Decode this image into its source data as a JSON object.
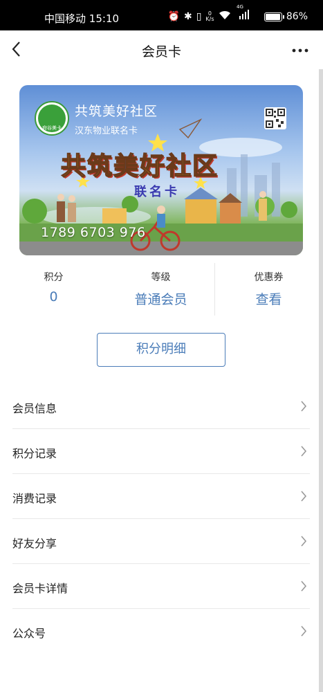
{
  "status_bar": {
    "carrier": "中国移动",
    "time": "15:10",
    "net_speed_value": "0",
    "net_speed_unit": "K/s",
    "network_type": "4G",
    "battery_percent": "86%",
    "battery_level": 0.86,
    "icons": [
      "alarm-icon",
      "bluetooth-icon",
      "vibrate-icon",
      "wifi-icon",
      "signal-icon",
      "battery-icon"
    ]
  },
  "nav": {
    "title": "会员卡",
    "back_icon": "chevron-left-icon",
    "more_icon": "more-dots-icon"
  },
  "card": {
    "org_name": "共筑美好社区",
    "subtitle": "汉东物业联名卡",
    "logo_text": "府谷美卡",
    "banner_title_1": "共筑",
    "banner_title_2": "美",
    "banner_title_3": "好社区",
    "banner_label": "联名卡",
    "card_number": "1789 6703 976",
    "qr_icon": "qr-code-icon"
  },
  "stats": [
    {
      "label": "积分",
      "value": "0"
    },
    {
      "label": "等级",
      "value": "普通会员"
    },
    {
      "label": "优惠券",
      "value": "查看"
    }
  ],
  "detail_button": "积分明细",
  "menu": [
    {
      "label": "会员信息"
    },
    {
      "label": "积分记录"
    },
    {
      "label": "消费记录"
    },
    {
      "label": "好友分享"
    },
    {
      "label": "会员卡详情"
    },
    {
      "label": "公众号"
    }
  ],
  "colors": {
    "accent": "#4a7cb8",
    "status_bar_bg": "#000000",
    "divider": "#e8e8e8"
  }
}
